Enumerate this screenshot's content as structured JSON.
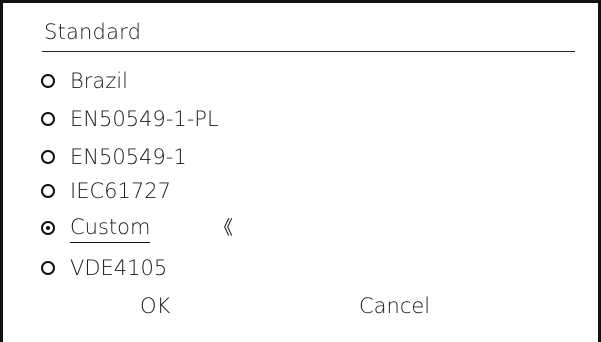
{
  "dialog": {
    "title": "Standard"
  },
  "options": [
    {
      "label": "Brazil",
      "selected": false
    },
    {
      "label": "EN50549-1-PL",
      "selected": false
    },
    {
      "label": "EN50549-1",
      "selected": false
    },
    {
      "label": "IEC61727",
      "selected": false
    },
    {
      "label": "Custom",
      "selected": true
    },
    {
      "label": "VDE4105",
      "selected": false
    }
  ],
  "focus_marker": "《",
  "buttons": {
    "ok_label": "OK",
    "cancel_label": "Cancel"
  }
}
